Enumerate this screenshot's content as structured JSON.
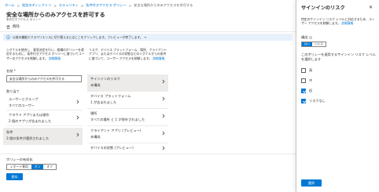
{
  "breadcrumb": {
    "home": "ホーム",
    "directory": "既定のディレクトリ",
    "security": "セキュリティ",
    "ca": "条件付きアクセス ポリシー",
    "current": "安全な場所からのみアクセスを許可する"
  },
  "page": {
    "title": "安全な場所からのみアクセスを許可する",
    "subtitle": "条件付きアクセス ポリシー",
    "delete_label": "削除",
    "banner_text": "以前の機能エクスペリエンスに切り替えるにはここをクリックします。プレビューが終了します。 →"
  },
  "left": {
    "desc": "シグナルを統合し、意思決定を行い、組織のポリシーを適用するために、条件付きアクセス ポリシーに基づいてユーザーのアクセスを制御します。",
    "desc_link": "詳細情報",
    "name_label": "名前 *",
    "name_value": "安全な場所からのみアクセスを許可する",
    "assign_label": "割り当て",
    "rows": [
      {
        "title": "ユーザーとグループ",
        "sub": "すべてのユーザー"
      },
      {
        "title": "クラウド アプリまたは操作",
        "sub": "2 個のアプリが含まれました"
      },
      {
        "title": "条件",
        "sub": "3 個の条件が選択されました"
      }
    ]
  },
  "middle": {
    "desc": "リスク、デバイス プラットフォーム、場所、クライアント アプリ、またはデバイスの状態などのシグナルからの条件に基づいて、ユーザー アクセスを制御します。",
    "desc_link": "詳細情報",
    "rows": [
      {
        "title": "サインインのリスク",
        "sub": "未構成"
      },
      {
        "title": "デバイス プラットフォーム",
        "sub": "1 が含まれました"
      },
      {
        "title": "場所",
        "sub": "すべての場所 と 1 が除外されました"
      },
      {
        "title": "クライアント アプリ (プレビュー)",
        "sub": "未構成"
      },
      {
        "title": "デバイスの状態 (プレビュー)",
        "sub": ""
      }
    ]
  },
  "bottom": {
    "policy_label": "ポリシーの有効化",
    "toggle": [
      "レポート専用",
      "オン",
      "オフ"
    ],
    "toggle_active": "オン",
    "save_label": "保存"
  },
  "panel": {
    "title": "サインインのリスク",
    "close": "✕",
    "desc": "特定のサインイン リスク レベルに対応するため、ユーザー アクセスを制御します。",
    "desc_link": "詳細情報",
    "config_label": "構成",
    "toggle": [
      "はい",
      "いいえ"
    ],
    "toggle_active": "はい",
    "question": "このポリシーを適用するサインイン リスク レベルを選択します",
    "options": [
      {
        "label": "高",
        "checked": false
      },
      {
        "label": "中",
        "checked": false
      },
      {
        "label": "低",
        "checked": true
      },
      {
        "label": "リスクなし",
        "checked": true
      }
    ],
    "select_label": "選択"
  },
  "colors": {
    "accent": "#0078d4",
    "banner": "#e8f1fb",
    "selected_row": "#edebe9"
  }
}
